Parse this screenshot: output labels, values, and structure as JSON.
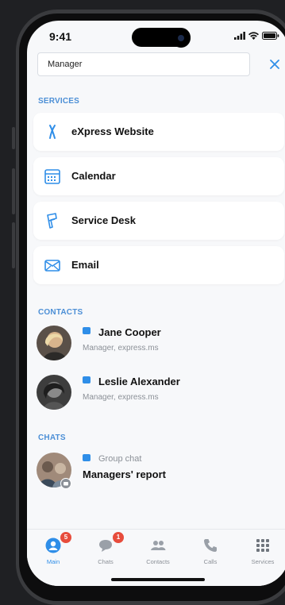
{
  "status_bar": {
    "time": "9:41"
  },
  "search": {
    "value": "Manager",
    "close_icon": "close-icon"
  },
  "services": {
    "header": "SERVICES",
    "items": [
      {
        "label": "eXpress Website",
        "icon": "express-icon"
      },
      {
        "label": "Calendar",
        "icon": "calendar-icon"
      },
      {
        "label": "Service Desk",
        "icon": "service-desk-icon"
      },
      {
        "label": "Email",
        "icon": "email-icon"
      }
    ]
  },
  "contacts": {
    "header": "CONTACTS",
    "items": [
      {
        "name": "Jane Cooper",
        "subtitle": "Manager, express.ms"
      },
      {
        "name": "Leslie Alexander",
        "subtitle": "Manager, express.ms"
      }
    ]
  },
  "chats": {
    "header": "CHATS",
    "items": [
      {
        "type": "Group chat",
        "title": "Managers' report"
      }
    ]
  },
  "tabbar": {
    "items": [
      {
        "label": "Main",
        "badge": "5",
        "active": true
      },
      {
        "label": "Chats",
        "badge": "1",
        "active": false
      },
      {
        "label": "Contacts",
        "badge": "",
        "active": false
      },
      {
        "label": "Calls",
        "badge": "",
        "active": false
      },
      {
        "label": "Services",
        "badge": "",
        "active": false
      }
    ]
  },
  "colors": {
    "accent": "#2f8ee8",
    "badge": "#e74c3c",
    "section": "#4c8fd6"
  }
}
